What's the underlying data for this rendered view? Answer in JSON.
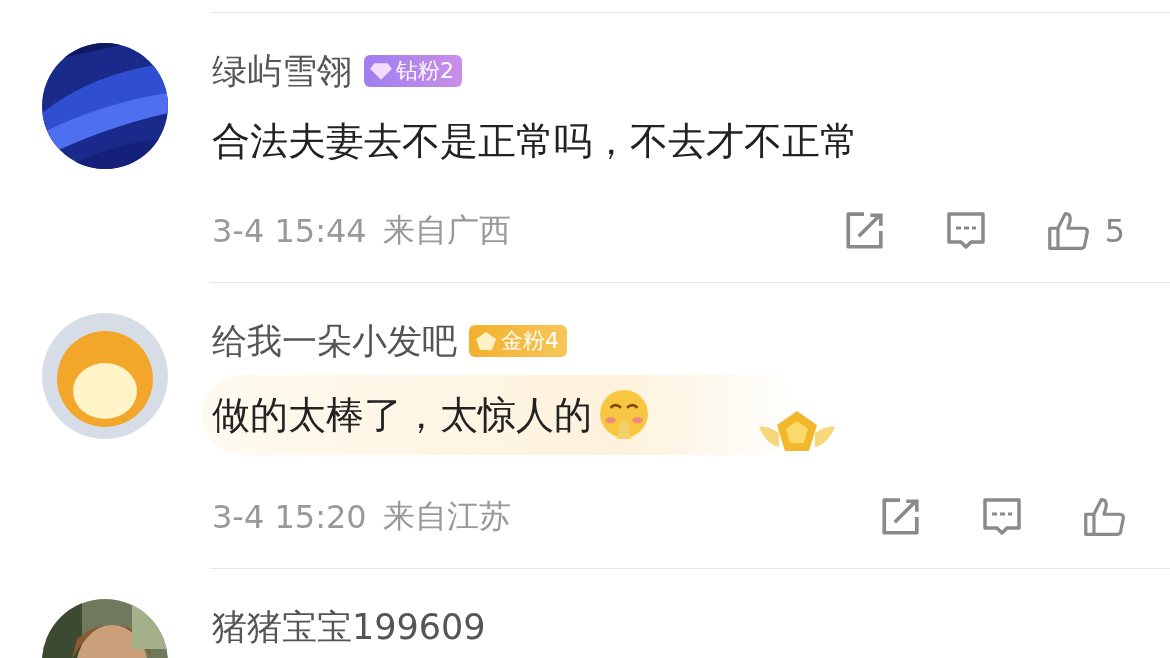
{
  "comments": [
    {
      "name": "绿屿雪翎",
      "badge": {
        "kind": "diamond",
        "label": "钻粉2"
      },
      "text": "合法夫妻去不是正常吗，不去才不正常",
      "emoji": false,
      "decorated": false,
      "time": "3-4 15:44",
      "location": "来自广西",
      "like_count": "5"
    },
    {
      "avatar": {
        "kind": "cartoon"
      },
      "name": "给我一朵小发吧",
      "badge": {
        "kind": "gold",
        "label": "金粉4"
      },
      "text": "做的太棒了，太惊人的",
      "emoji": true,
      "decorated": true,
      "time": "3-4 15:20",
      "location": "来自江苏"
    },
    {
      "name": "猪猪宝宝199609"
    }
  ]
}
